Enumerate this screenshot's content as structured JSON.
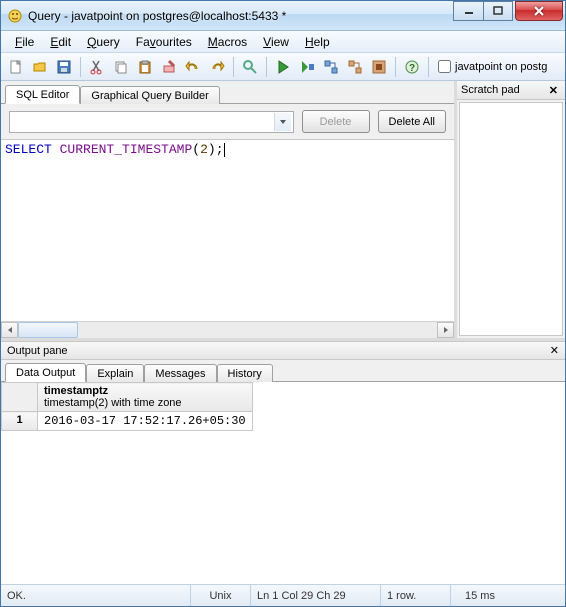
{
  "window": {
    "title": "Query - javatpoint on postgres@localhost:5433 *"
  },
  "menu": {
    "file": "File",
    "edit": "Edit",
    "query": "Query",
    "favourites": "Favourites",
    "macros": "Macros",
    "view": "View",
    "help": "Help"
  },
  "toolbar": {
    "connection_label": "javatpoint on postg"
  },
  "tabs": {
    "sql_editor": "SQL Editor",
    "gqb": "Graphical Query Builder"
  },
  "editor": {
    "delete_btn": "Delete",
    "delete_all_btn": "Delete All",
    "sql_kw_select": "SELECT",
    "sql_fn": "CURRENT_TIMESTAMP",
    "sql_arg": "2",
    "sql_terminator": ";"
  },
  "scratch": {
    "title": "Scratch pad"
  },
  "output": {
    "pane_title": "Output pane",
    "tabs": {
      "data": "Data Output",
      "explain": "Explain",
      "messages": "Messages",
      "history": "History"
    },
    "col_header_main": "timestamptz",
    "col_header_sub": "timestamp(2) with time zone",
    "row1_num": "1",
    "row1_val": "2016-03-17 17:52:17.26+05:30"
  },
  "status": {
    "ok": "OK.",
    "encoding": "Unix",
    "cursor": "Ln 1 Col 29 Ch 29",
    "rows": "1 row.",
    "time": "15 ms"
  }
}
